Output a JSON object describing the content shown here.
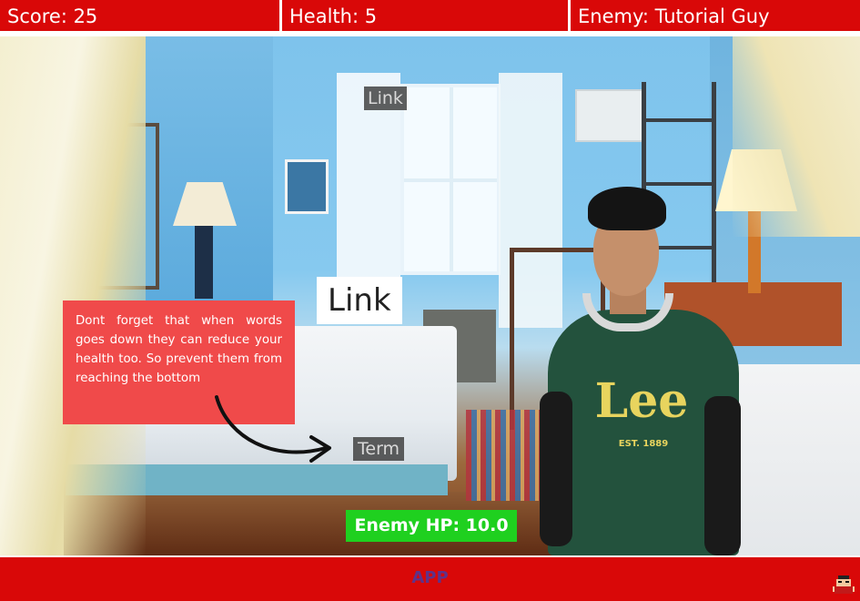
{
  "hud": {
    "score": "Score: 25",
    "health": "Health: 5",
    "enemy": "Enemy: Tutorial Guy"
  },
  "words": {
    "falling_top": "Link",
    "active_target": "Link",
    "falling_bottom": "Term"
  },
  "tutorial_tip": "Dont forget that when words goes down they can reduce your health too. So prevent them from reaching the bottom",
  "enemy_hp": "Enemy HP: 10.0",
  "bottom_bar": {
    "label": "APP",
    "icon": "pixel-character-icon"
  },
  "character": {
    "shirt_logo": "Lee",
    "shirt_text": "EST. 1889"
  },
  "colors": {
    "hud_red": "#d90808",
    "tip_red": "#f04a4a",
    "hp_green": "#1fd01f"
  }
}
